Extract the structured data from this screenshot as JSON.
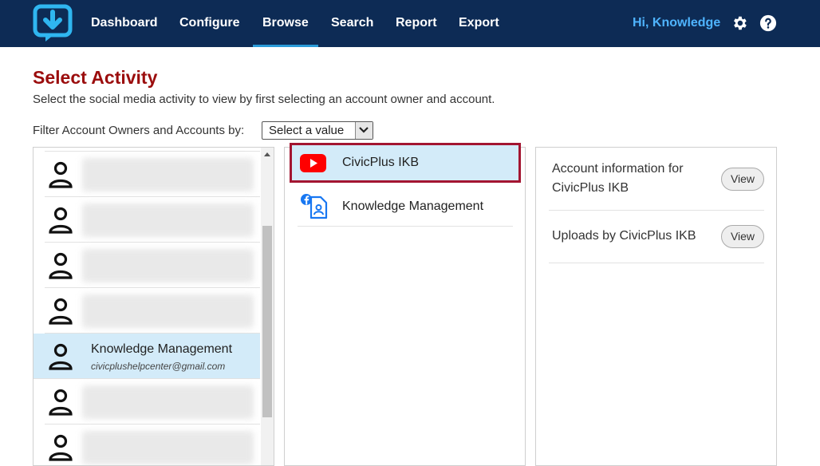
{
  "nav": {
    "items": [
      "Dashboard",
      "Configure",
      "Browse",
      "Search",
      "Report",
      "Export"
    ],
    "active": "Browse",
    "greeting": "Hi, Knowledge",
    "icons": [
      "gear-icon",
      "help-icon"
    ]
  },
  "page": {
    "title": "Select Activity",
    "subtitle": "Select the social media activity to view by first selecting an account owner and account.",
    "filter_label": "Filter Account Owners and Accounts by:",
    "filter_value": "Select a value"
  },
  "owners": {
    "selected": {
      "name": "Knowledge Management",
      "email": "civicplushelpcenter@gmail.com"
    }
  },
  "accounts": [
    {
      "label": "CivicPlus IKB",
      "icon": "youtube-icon"
    },
    {
      "label": "Knowledge Management",
      "icon": "facebook-page-icon"
    }
  ],
  "info": [
    {
      "label": "Account information for CivicPlus IKB",
      "button": "View"
    },
    {
      "label": "Uploads by CivicPlus IKB",
      "button": "View"
    }
  ],
  "colors": {
    "nav_bg": "#0d2b55",
    "active_underline": "#2a9bd8",
    "title": "#9b0d0d",
    "selected_row": "#d3ebf9",
    "highlight_border": "#a31531",
    "greeting": "#4fb4ff"
  }
}
